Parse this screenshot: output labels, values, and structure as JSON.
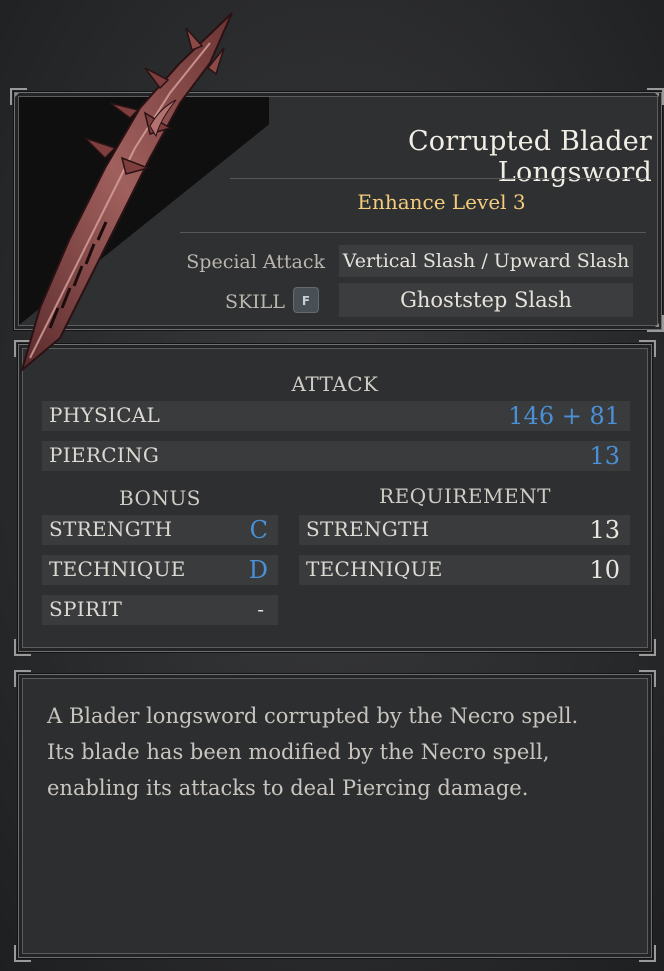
{
  "item": {
    "name": "Corrupted Blader Longsword",
    "enhance_level": "Enhance Level 3",
    "special_attack_label": "Special Attack",
    "special_attack_value": "Vertical Slash / Upward Slash",
    "skill_label": "SKILL",
    "skill_key": "F",
    "skill_value": "Ghoststep Slash"
  },
  "attack": {
    "title": "ATTACK",
    "rows": [
      {
        "label": "PHYSICAL",
        "value": "146 + 81"
      },
      {
        "label": "PIERCING",
        "value": "13"
      }
    ]
  },
  "bonus": {
    "title": "BONUS",
    "rows": [
      {
        "label": "STRENGTH",
        "value": "C"
      },
      {
        "label": "TECHNIQUE",
        "value": "D"
      },
      {
        "label": "SPIRIT",
        "value": "-"
      }
    ]
  },
  "requirement": {
    "title": "REQUIREMENT",
    "rows": [
      {
        "label": "STRENGTH",
        "value": "13"
      },
      {
        "label": "TECHNIQUE",
        "value": "10"
      }
    ]
  },
  "description": {
    "lines": [
      "A Blader longsword corrupted by the Necro spell.",
      "Its blade has been modified by the Necro spell,",
      "enabling its attacks to deal Piercing damage."
    ]
  },
  "colors": {
    "enhance": "#f3cd7c",
    "stat_blue": "#4a90d6",
    "panel": "#2f3032",
    "row": "#3a3b3d"
  },
  "icons": {
    "weapon": "corrupted-longsword-icon",
    "corner": "ornate-corner-icon"
  }
}
